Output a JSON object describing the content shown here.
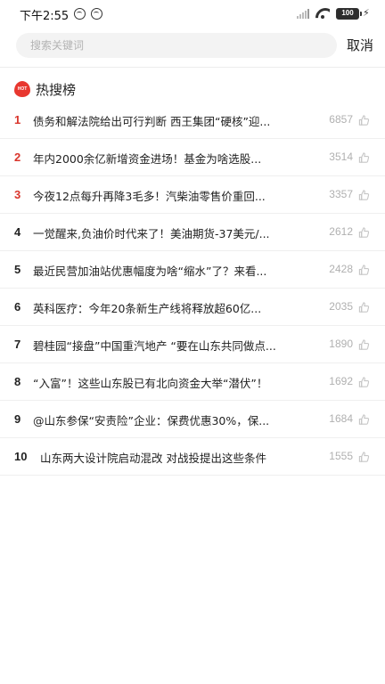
{
  "status_bar": {
    "time": "下午2:55",
    "battery": "100"
  },
  "search": {
    "placeholder": "搜索关键词",
    "cancel_label": "取消"
  },
  "hot_list": {
    "title": "热搜榜",
    "items": [
      {
        "rank": "1",
        "title": "债务和解法院给出可行判断 西王集团“硬核”迎...",
        "count": "6857"
      },
      {
        "rank": "2",
        "title": "年内2000余亿新增资金进场！基金为啥选股...",
        "count": "3514"
      },
      {
        "rank": "3",
        "title": "今夜12点每升再降3毛多！汽柴油零售价重回...",
        "count": "3357"
      },
      {
        "rank": "4",
        "title": "一觉醒来,负油价时代来了！美油期货-37美元/...",
        "count": "2612"
      },
      {
        "rank": "5",
        "title": "最近民营加油站优惠幅度为啥“缩水”了？来看...",
        "count": "2428"
      },
      {
        "rank": "6",
        "title": "英科医疗：今年20条新生产线将释放超60亿...",
        "count": "2035"
      },
      {
        "rank": "7",
        "title": "碧桂园“接盘”中国重汽地产 “要在山东共同做点...",
        "count": "1890"
      },
      {
        "rank": "8",
        "title": "“入富”！这些山东股已有北向资金大举“潜伏”！",
        "count": "1692"
      },
      {
        "rank": "9",
        "title": "@山东参保“安责险”企业：保费优惠30%，保...",
        "count": "1684"
      },
      {
        "rank": "10",
        "title": "山东两大设计院启动混改 对战投提出这些条件",
        "count": "1555"
      }
    ]
  },
  "colors": {
    "accent_red": "#d9342b",
    "count_gray": "#b0b0b0"
  },
  "icons": {
    "status": [
      "app-icon",
      "app-icon",
      "signal-icon",
      "wifi-icon",
      "battery-icon",
      "charging-icon"
    ],
    "row": "thumbs-up-icon",
    "header": "hot-icon"
  }
}
